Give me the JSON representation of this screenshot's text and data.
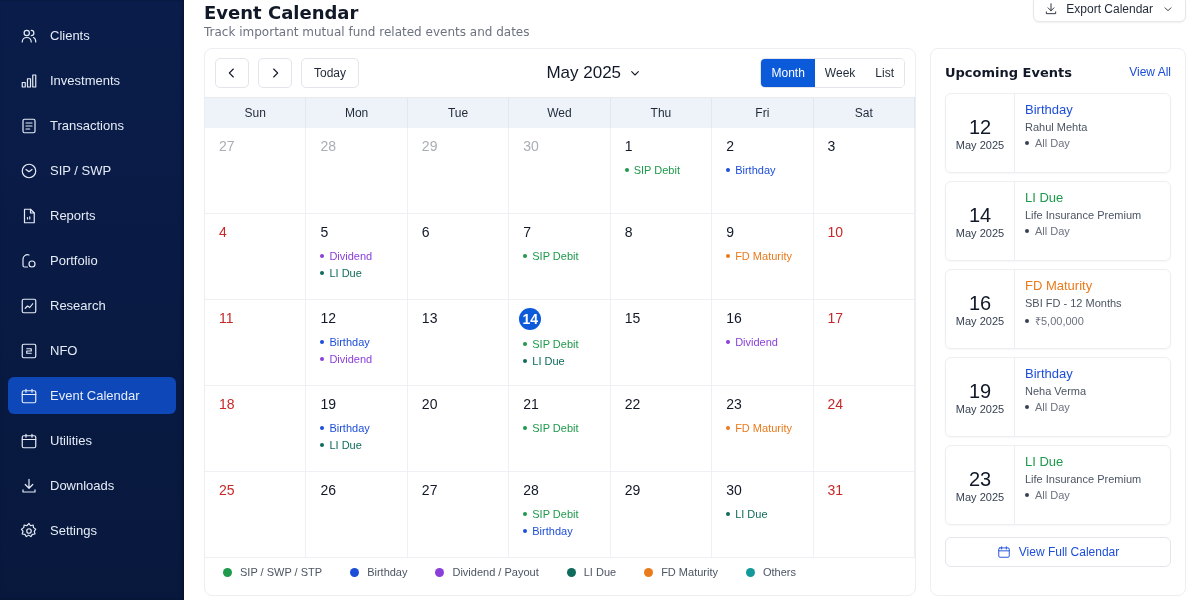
{
  "sidebar": {
    "items": [
      {
        "label": "Clients",
        "selected": false
      },
      {
        "label": "Investments",
        "selected": false
      },
      {
        "label": "Transactions",
        "selected": false
      },
      {
        "label": "SIP / SWP",
        "selected": false
      },
      {
        "label": "Reports",
        "selected": false
      },
      {
        "label": "Portfolio",
        "selected": false
      },
      {
        "label": "Research",
        "selected": false
      },
      {
        "label": "NFO",
        "selected": false
      },
      {
        "label": "Event Calendar",
        "selected": true
      },
      {
        "label": "Utilities",
        "selected": false
      },
      {
        "label": "Downloads",
        "selected": false
      },
      {
        "label": "Settings",
        "selected": false
      }
    ]
  },
  "header": {
    "title": "Event Calendar",
    "subtitle": "Track important mutual fund related events and dates",
    "export_button": "Export Calendar"
  },
  "calendar": {
    "today_button": "Today",
    "month_label": "May 2025",
    "views": [
      {
        "label": "Month",
        "selected": true
      },
      {
        "label": "Week",
        "selected": false
      },
      {
        "label": "List",
        "selected": false
      }
    ],
    "weekdays": [
      "Sun",
      "Mon",
      "Tue",
      "Wed",
      "Thu",
      "Fri",
      "Sat"
    ],
    "weeks": [
      [
        {
          "day": "27",
          "outside_month": true,
          "holiday": false,
          "selected": false
        },
        {
          "day": "28",
          "outside_month": true,
          "holiday": false,
          "selected": false
        },
        {
          "day": "29",
          "outside_month": true,
          "holiday": false,
          "selected": false
        },
        {
          "day": "30",
          "outside_month": true,
          "holiday": false,
          "selected": false
        },
        {
          "day": "1",
          "outside_month": false,
          "holiday": false,
          "selected": false,
          "events": [
            {
              "label": "SIP Debit",
              "color": "#1e9a4c"
            }
          ]
        },
        {
          "day": "2",
          "outside_month": false,
          "holiday": false,
          "selected": false,
          "events": [
            {
              "label": "Birthday",
              "color": "#1d4ed8"
            }
          ]
        },
        {
          "day": "3",
          "outside_month": false,
          "holiday": false,
          "selected": false
        }
      ],
      [
        {
          "day": "4",
          "outside_month": false,
          "holiday": true,
          "selected": false
        },
        {
          "day": "5",
          "outside_month": false,
          "holiday": false,
          "selected": false,
          "events": [
            {
              "label": "Dividend",
              "color": "#8b3fd9"
            },
            {
              "label": "LI Due",
              "color": "#0f6b5c"
            }
          ]
        },
        {
          "day": "6",
          "outside_month": false,
          "holiday": false,
          "selected": false
        },
        {
          "day": "7",
          "outside_month": false,
          "holiday": false,
          "selected": false,
          "events": [
            {
              "label": "SIP Debit",
              "color": "#1e9a4c"
            }
          ]
        },
        {
          "day": "8",
          "outside_month": false,
          "holiday": false,
          "selected": false
        },
        {
          "day": "9",
          "outside_month": false,
          "holiday": false,
          "selected": false,
          "events": [
            {
              "label": "FD Maturity",
              "color": "#ea7b1c"
            }
          ]
        },
        {
          "day": "10",
          "outside_month": false,
          "holiday": true,
          "selected": false
        }
      ],
      [
        {
          "day": "11",
          "outside_month": false,
          "holiday": true,
          "selected": false
        },
        {
          "day": "12",
          "outside_month": false,
          "holiday": false,
          "selected": false,
          "events": [
            {
              "label": "Birthday",
              "color": "#1d4ed8"
            },
            {
              "label": "Dividend",
              "color": "#8b3fd9"
            }
          ]
        },
        {
          "day": "13",
          "outside_month": false,
          "holiday": false,
          "selected": false
        },
        {
          "day": "14",
          "outside_month": false,
          "holiday": false,
          "selected": true,
          "events": [
            {
              "label": "SIP Debit",
              "color": "#1e9a4c"
            },
            {
              "label": "LI Due",
              "color": "#0f6b5c"
            }
          ]
        },
        {
          "day": "15",
          "outside_month": false,
          "holiday": false,
          "selected": false
        },
        {
          "day": "16",
          "outside_month": false,
          "holiday": false,
          "selected": false,
          "events": [
            {
              "label": "Dividend",
              "color": "#8b3fd9"
            }
          ]
        },
        {
          "day": "17",
          "outside_month": false,
          "holiday": true,
          "selected": false
        }
      ],
      [
        {
          "day": "18",
          "outside_month": false,
          "holiday": true,
          "selected": false
        },
        {
          "day": "19",
          "outside_month": false,
          "holiday": false,
          "selected": false,
          "events": [
            {
              "label": "Birthday",
              "color": "#1d4ed8"
            },
            {
              "label": "LI Due",
              "color": "#0f6b5c"
            }
          ]
        },
        {
          "day": "20",
          "outside_month": false,
          "holiday": false,
          "selected": false
        },
        {
          "day": "21",
          "outside_month": false,
          "holiday": false,
          "selected": false,
          "events": [
            {
              "label": "SIP Debit",
              "color": "#1e9a4c"
            }
          ]
        },
        {
          "day": "22",
          "outside_month": false,
          "holiday": false,
          "selected": false
        },
        {
          "day": "23",
          "outside_month": false,
          "holiday": false,
          "selected": false,
          "events": [
            {
              "label": "FD Maturity",
              "color": "#ea7b1c"
            }
          ]
        },
        {
          "day": "24",
          "outside_month": false,
          "holiday": true,
          "selected": false
        }
      ],
      [
        {
          "day": "25",
          "outside_month": false,
          "holiday": true,
          "selected": false
        },
        {
          "day": "26",
          "outside_month": false,
          "holiday": false,
          "selected": false
        },
        {
          "day": "27",
          "outside_month": false,
          "holiday": false,
          "selected": false
        },
        {
          "day": "28",
          "outside_month": false,
          "holiday": false,
          "selected": false,
          "events": [
            {
              "label": "SIP Debit",
              "color": "#1e9a4c"
            },
            {
              "label": "Birthday",
              "color": "#1d4ed8"
            }
          ]
        },
        {
          "day": "29",
          "outside_month": false,
          "holiday": false,
          "selected": false
        },
        {
          "day": "30",
          "outside_month": false,
          "holiday": false,
          "selected": false,
          "events": [
            {
              "label": "LI Due",
              "color": "#0f6b5c"
            }
          ]
        },
        {
          "day": "31",
          "outside_month": false,
          "holiday": true,
          "selected": false
        }
      ]
    ],
    "legend": [
      {
        "label": "SIP / SWP / STP",
        "color": "#1e9a4c"
      },
      {
        "label": "Birthday",
        "color": "#1d4ed8"
      },
      {
        "label": "Dividend / Payout",
        "color": "#8b3fd9"
      },
      {
        "label": "LI Due",
        "color": "#0f6b5c"
      },
      {
        "label": "FD Maturity",
        "color": "#ea7b1c"
      },
      {
        "label": "Others",
        "color": "#14999a"
      }
    ]
  },
  "upcoming": {
    "title": "Upcoming Events",
    "view_all": "View All",
    "footer_button": "View Full Calendar",
    "events": [
      {
        "day": "12",
        "month": "May 2025",
        "title": "Birthday",
        "color": "#1d4ed8",
        "subtitle": "Rahul Mehta",
        "detail": "All Day"
      },
      {
        "day": "14",
        "month": "May 2025",
        "title": "LI Due",
        "color": "#1e9a4c",
        "subtitle": "Life Insurance Premium",
        "detail": "All Day"
      },
      {
        "day": "16",
        "month": "May 2025",
        "title": "FD Maturity",
        "color": "#ea7b1c",
        "subtitle": "SBI FD - 12 Months",
        "detail": "₹5,00,000"
      },
      {
        "day": "19",
        "month": "May 2025",
        "title": "Birthday",
        "color": "#1d4ed8",
        "subtitle": "Neha Verma",
        "detail": "All Day"
      },
      {
        "day": "23",
        "month": "May 2025",
        "title": "LI Due",
        "color": "#1e9a4c",
        "subtitle": "Life Insurance Premium",
        "detail": "All Day"
      }
    ]
  }
}
